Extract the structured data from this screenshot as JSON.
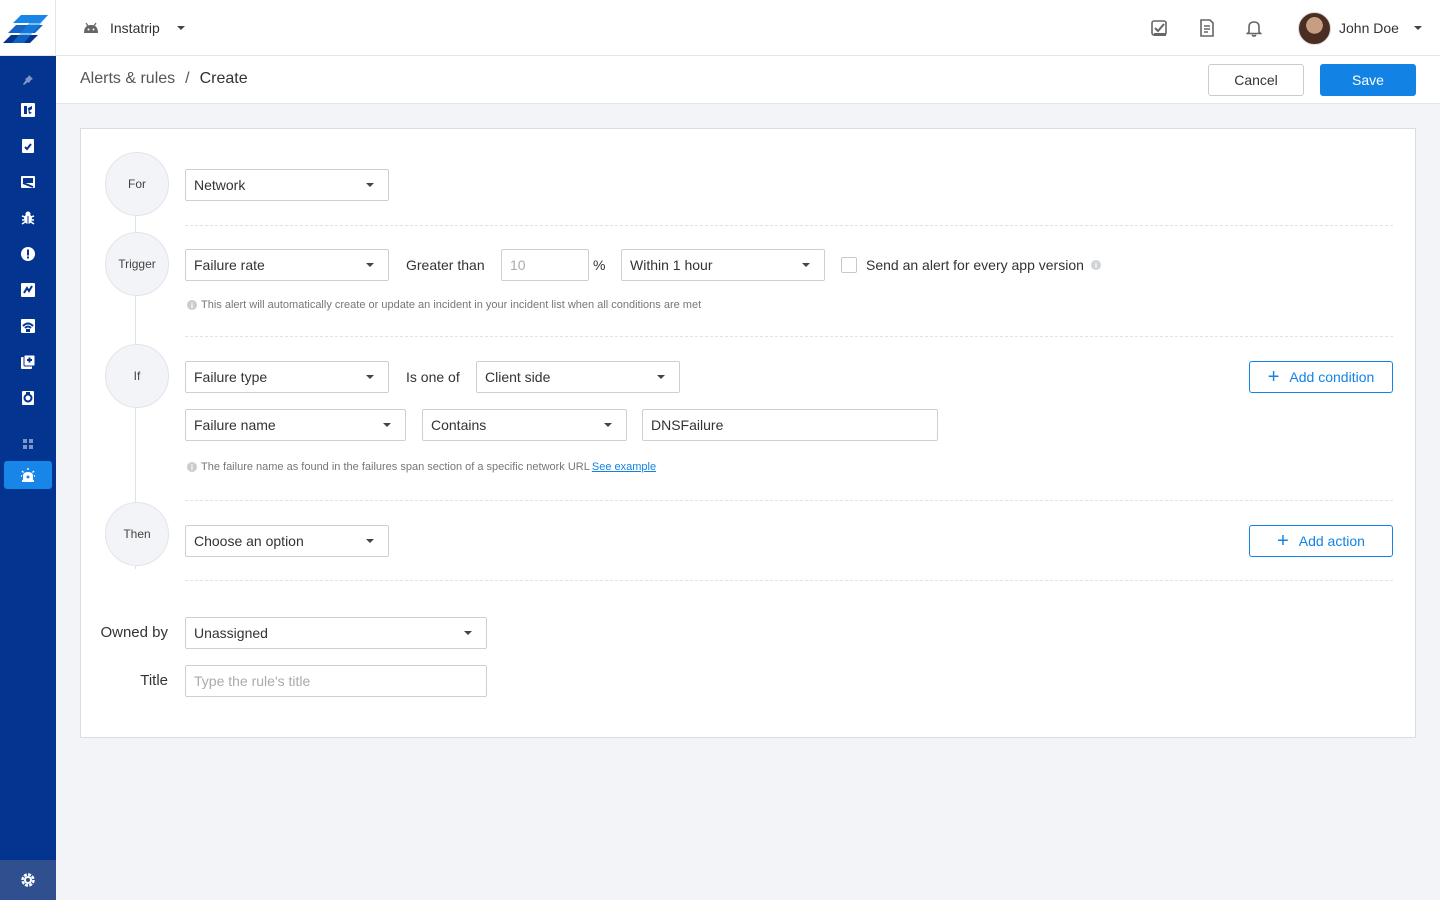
{
  "app": {
    "name": "Instatrip"
  },
  "user": {
    "name": "John Doe"
  },
  "sidebar": {
    "items": [
      {
        "name": "pin-icon"
      },
      {
        "name": "dashboard-icon"
      },
      {
        "name": "reports-icon"
      },
      {
        "name": "inbox-icon"
      },
      {
        "name": "bug-icon"
      },
      {
        "name": "crash-icon"
      },
      {
        "name": "apm-icon"
      },
      {
        "name": "network-icon"
      },
      {
        "name": "releases-icon"
      },
      {
        "name": "surveys-icon"
      },
      {
        "name": "apps-grid-icon"
      },
      {
        "name": "alerts-icon",
        "active": true
      }
    ],
    "settings": "gear-icon"
  },
  "breadcrumb": {
    "parent": "Alerts & rules",
    "separator": "/",
    "current": "Create"
  },
  "actions": {
    "cancel": "Cancel",
    "save": "Save"
  },
  "rule": {
    "for": {
      "label": "For",
      "value": "Network"
    },
    "trigger": {
      "label": "Trigger",
      "metric": "Failure rate",
      "operator": "Greater than",
      "threshold_placeholder": "10",
      "unit": "%",
      "window": "Within 1 hour",
      "every_version_label": "Send an alert for every app version",
      "hint": "This alert will automatically create or update an incident in your incident list when all conditions are met"
    },
    "if": {
      "label": "If",
      "condition1": {
        "field": "Failure type",
        "operator": "Is one of",
        "value": "Client side"
      },
      "condition2": {
        "field": "Failure name",
        "operator": "Contains",
        "value": "DNSFailure"
      },
      "hint": "The failure name as found in the failures span section of a specific network URL",
      "hint_link": "See example",
      "add_condition": "Add condition"
    },
    "then": {
      "label": "Then",
      "value": "Choose an option",
      "add_action": "Add action"
    },
    "owned_by": {
      "label": "Owned by",
      "value": "Unassigned"
    },
    "title": {
      "label": "Title",
      "placeholder": "Type the rule's title"
    }
  },
  "colors": {
    "sidebar": "#03348f",
    "accent": "#1283e5",
    "active": "#1886e8"
  }
}
